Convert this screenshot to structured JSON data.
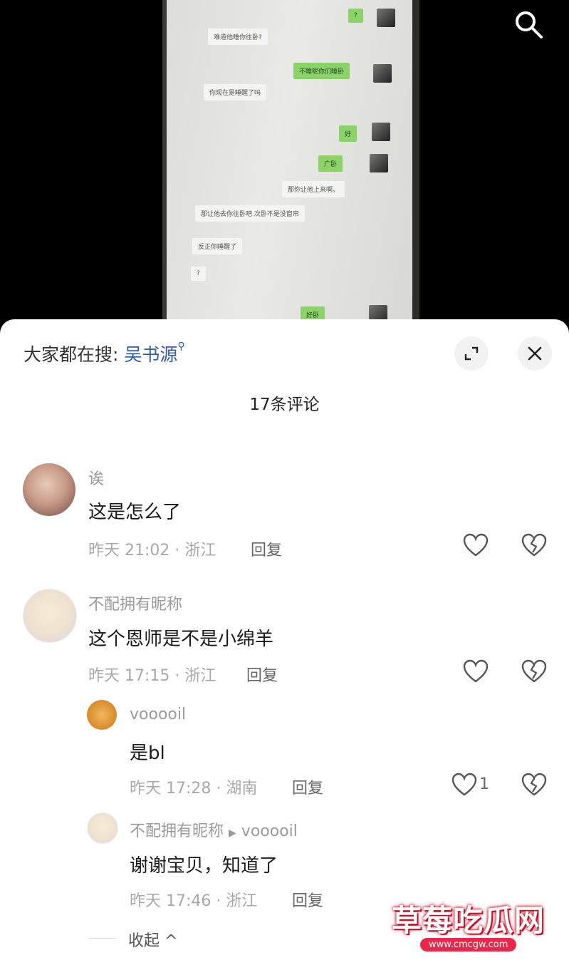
{
  "video": {
    "chat_messages": [
      {
        "side": "right",
        "text": "?"
      },
      {
        "side": "left",
        "text": "难道他睡你往卧?"
      },
      {
        "side": "right",
        "text": "不睡呢你们睡卧"
      },
      {
        "side": "left",
        "text": "你现在是睡醒了吗"
      },
      {
        "side": "right",
        "text": "好"
      },
      {
        "side": "right",
        "text": "广卧"
      },
      {
        "side": "left",
        "text": "那你让他上来啊。"
      },
      {
        "side": "left",
        "text": "那让他去你往卧吧 次卧不是没窗帘"
      },
      {
        "side": "left",
        "text": "反正你睡醒了"
      },
      {
        "side": "left",
        "text": "?"
      },
      {
        "side": "right",
        "text": "好卧"
      }
    ]
  },
  "sheet": {
    "search_prefix": "大家都在搜:",
    "search_term": "吴书源",
    "comment_count_label": "17条评论",
    "collapse_label": "收起 ^"
  },
  "comments": [
    {
      "username": "诶",
      "text": "这是怎么了",
      "meta": "昨天 21:02 · 浙江",
      "reply": "回复"
    },
    {
      "username": "不配拥有昵称",
      "text": "这个恩师是不是小绵羊",
      "meta": "昨天 17:15 · 浙江",
      "reply": "回复"
    }
  ],
  "replies": [
    {
      "username": "vooooil",
      "text": "是bl",
      "meta": "昨天 17:28 · 湖南",
      "reply": "回复",
      "likes": "1"
    },
    {
      "username": "不配拥有昵称",
      "reply_to": "vooooil",
      "text": "谢谢宝贝，知道了",
      "meta": "昨天 17:46 · 浙江",
      "reply": "回复"
    }
  ],
  "watermark": {
    "title": "草莓吃瓜网",
    "url": "www.cmcgw.com"
  },
  "icons": {
    "search": "search-icon",
    "expand": "expand-icon",
    "close": "close-icon",
    "like": "heart-icon",
    "dislike": "broken-heart-icon"
  },
  "colors": {
    "search_highlight": "#2f5aa8",
    "chat_green": "#8bd26a",
    "watermark_red": "#c4122a"
  }
}
